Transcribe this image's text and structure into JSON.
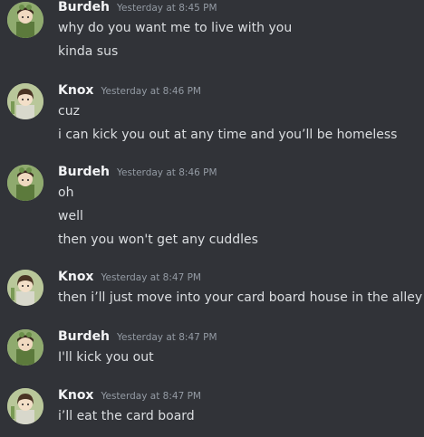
{
  "users": {
    "burdeh": {
      "name": "Burdeh",
      "avatar": "burdeh-avatar"
    },
    "knox": {
      "name": "Knox",
      "avatar": "knox-avatar"
    }
  },
  "messages": [
    {
      "author": "Burdeh",
      "timestamp": "Yesterday at 8:45 PM",
      "lines": [
        "why do you want me to live with you",
        "kinda sus"
      ]
    },
    {
      "author": "Knox",
      "timestamp": "Yesterday at 8:46 PM",
      "lines": [
        "cuz",
        "i can kick you out at any time and you’ll be homeless"
      ]
    },
    {
      "author": "Burdeh",
      "timestamp": "Yesterday at 8:46 PM",
      "lines": [
        "oh",
        "well",
        "then you won't get any cuddles"
      ]
    },
    {
      "author": "Knox",
      "timestamp": "Yesterday at 8:47 PM",
      "lines": [
        "then i’ll just move into your card board house in the alley"
      ]
    },
    {
      "author": "Burdeh",
      "timestamp": "Yesterday at 8:47 PM",
      "lines": [
        "I'll kick you out"
      ]
    },
    {
      "author": "Knox",
      "timestamp": "Yesterday at 8:47 PM",
      "lines": [
        "i’ll eat the card board"
      ]
    }
  ],
  "colors": {
    "background": "#313338",
    "username": "#f2f3f5",
    "timestamp": "#949ba4",
    "text": "#dbdee1"
  }
}
